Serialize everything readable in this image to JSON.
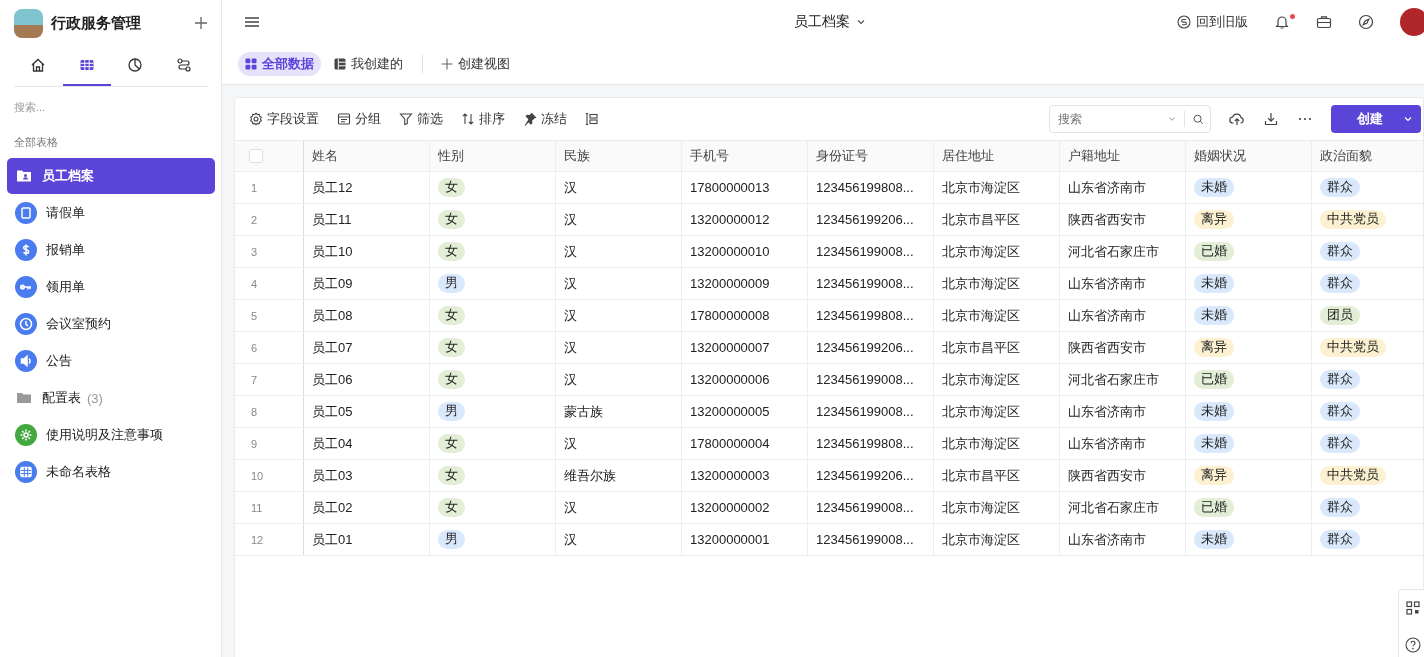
{
  "app": {
    "name": "行政服务管理"
  },
  "sidebar_tabs": [
    {
      "selected": false
    },
    {
      "selected": true
    },
    {
      "selected": false
    },
    {
      "selected": false
    }
  ],
  "sidebar_search": {
    "placeholder": "搜索..."
  },
  "sidebar_section": "全部表格",
  "sidebar": {
    "items": [
      {
        "label": "员工档案",
        "kind": "table",
        "selected": true
      },
      {
        "label": "请假单",
        "kind": "table",
        "selected": false,
        "color": "#4a7cf0"
      },
      {
        "label": "报销单",
        "kind": "table",
        "selected": false,
        "color": "#4a7cf0"
      },
      {
        "label": "领用单",
        "kind": "table",
        "selected": false,
        "color": "#4a7cf0"
      },
      {
        "label": "会议室预约",
        "kind": "table",
        "selected": false,
        "color": "#4a7cf0"
      },
      {
        "label": "公告",
        "kind": "table",
        "selected": false,
        "color": "#4a7cf0"
      },
      {
        "label": "配置表",
        "kind": "folder",
        "selected": false,
        "count": "(3)"
      },
      {
        "label": "使用说明及注意事项",
        "kind": "table",
        "selected": false,
        "color": "#43a83f"
      },
      {
        "label": "未命名表格",
        "kind": "table",
        "selected": false,
        "color": "#4a7cf0"
      }
    ]
  },
  "header": {
    "title": "员工档案",
    "old_version": "回到旧版",
    "notification_dot": true
  },
  "views": [
    {
      "label": "全部数据",
      "selected": true
    },
    {
      "label": "我创建的",
      "selected": false
    }
  ],
  "create_view": "创建视图",
  "toolbar": [
    "字段设置",
    "分组",
    "筛选",
    "排序",
    "冻结"
  ],
  "search": {
    "placeholder": "搜索"
  },
  "create_button": "创建",
  "table": {
    "select_all": {
      "checked": false
    },
    "columns": [
      "姓名",
      "性别",
      "民族",
      "手机号",
      "身份证号",
      "居住地址",
      "户籍地址",
      "婚姻状况",
      "政治面貌"
    ],
    "rows": [
      {
        "index": "1",
        "name": "员工12",
        "gender": {
          "text": "女",
          "color": "#e2eed5"
        },
        "ethnicity": "汉",
        "phone": "17800000013",
        "id_number": "123456199808...",
        "residence": "北京市海淀区",
        "hukou": "山东省济南市",
        "marital": {
          "text": "未婚",
          "color": "#d9e8fb"
        },
        "political": {
          "text": "群众",
          "color": "#d9e8fb"
        }
      },
      {
        "index": "2",
        "name": "员工11",
        "gender": {
          "text": "女",
          "color": "#e2eed5"
        },
        "ethnicity": "汉",
        "phone": "13200000012",
        "id_number": "123456199206...",
        "residence": "北京市昌平区",
        "hukou": "陕西省西安市",
        "marital": {
          "text": "离异",
          "color": "#fcf1d0"
        },
        "political": {
          "text": "中共党员",
          "color": "#fcf1d0"
        }
      },
      {
        "index": "3",
        "name": "员工10",
        "gender": {
          "text": "女",
          "color": "#e2eed5"
        },
        "ethnicity": "汉",
        "phone": "13200000010",
        "id_number": "123456199008...",
        "residence": "北京市海淀区",
        "hukou": "河北省石家庄市",
        "marital": {
          "text": "已婚",
          "color": "#e2eed5"
        },
        "political": {
          "text": "群众",
          "color": "#d9e8fb"
        }
      },
      {
        "index": "4",
        "name": "员工09",
        "gender": {
          "text": "男",
          "color": "#d9e8fb"
        },
        "ethnicity": "汉",
        "phone": "13200000009",
        "id_number": "123456199008...",
        "residence": "北京市海淀区",
        "hukou": "山东省济南市",
        "marital": {
          "text": "未婚",
          "color": "#d9e8fb"
        },
        "political": {
          "text": "群众",
          "color": "#d9e8fb"
        }
      },
      {
        "index": "5",
        "name": "员工08",
        "gender": {
          "text": "女",
          "color": "#e2eed5"
        },
        "ethnicity": "汉",
        "phone": "17800000008",
        "id_number": "123456199808...",
        "residence": "北京市海淀区",
        "hukou": "山东省济南市",
        "marital": {
          "text": "未婚",
          "color": "#d9e8fb"
        },
        "political": {
          "text": "团员",
          "color": "#e2eed5"
        }
      },
      {
        "index": "6",
        "name": "员工07",
        "gender": {
          "text": "女",
          "color": "#e2eed5"
        },
        "ethnicity": "汉",
        "phone": "13200000007",
        "id_number": "123456199206...",
        "residence": "北京市昌平区",
        "hukou": "陕西省西安市",
        "marital": {
          "text": "离异",
          "color": "#fcf1d0"
        },
        "political": {
          "text": "中共党员",
          "color": "#fcf1d0"
        }
      },
      {
        "index": "7",
        "name": "员工06",
        "gender": {
          "text": "女",
          "color": "#e2eed5"
        },
        "ethnicity": "汉",
        "phone": "13200000006",
        "id_number": "123456199008...",
        "residence": "北京市海淀区",
        "hukou": "河北省石家庄市",
        "marital": {
          "text": "已婚",
          "color": "#e2eed5"
        },
        "political": {
          "text": "群众",
          "color": "#d9e8fb"
        }
      },
      {
        "index": "8",
        "name": "员工05",
        "gender": {
          "text": "男",
          "color": "#d9e8fb"
        },
        "ethnicity": "蒙古族",
        "phone": "13200000005",
        "id_number": "123456199008...",
        "residence": "北京市海淀区",
        "hukou": "山东省济南市",
        "marital": {
          "text": "未婚",
          "color": "#d9e8fb"
        },
        "political": {
          "text": "群众",
          "color": "#d9e8fb"
        }
      },
      {
        "index": "9",
        "name": "员工04",
        "gender": {
          "text": "女",
          "color": "#e2eed5"
        },
        "ethnicity": "汉",
        "phone": "17800000004",
        "id_number": "123456199808...",
        "residence": "北京市海淀区",
        "hukou": "山东省济南市",
        "marital": {
          "text": "未婚",
          "color": "#d9e8fb"
        },
        "political": {
          "text": "群众",
          "color": "#d9e8fb"
        }
      },
      {
        "index": "10",
        "name": "员工03",
        "gender": {
          "text": "女",
          "color": "#e2eed5"
        },
        "ethnicity": "维吾尔族",
        "phone": "13200000003",
        "id_number": "123456199206...",
        "residence": "北京市昌平区",
        "hukou": "陕西省西安市",
        "marital": {
          "text": "离异",
          "color": "#fcf1d0"
        },
        "political": {
          "text": "中共党员",
          "color": "#fcf1d0"
        }
      },
      {
        "index": "11",
        "name": "员工02",
        "gender": {
          "text": "女",
          "color": "#e2eed5"
        },
        "ethnicity": "汉",
        "phone": "13200000002",
        "id_number": "123456199008...",
        "residence": "北京市海淀区",
        "hukou": "河北省石家庄市",
        "marital": {
          "text": "已婚",
          "color": "#e2eed5"
        },
        "political": {
          "text": "群众",
          "color": "#d9e8fb"
        }
      },
      {
        "index": "12",
        "name": "员工01",
        "gender": {
          "text": "男",
          "color": "#d9e8fb"
        },
        "ethnicity": "汉",
        "phone": "13200000001",
        "id_number": "123456199008...",
        "residence": "北京市海淀区",
        "hukou": "山东省济南市",
        "marital": {
          "text": "未婚",
          "color": "#d9e8fb"
        },
        "political": {
          "text": "群众",
          "color": "#d9e8fb"
        }
      }
    ]
  }
}
